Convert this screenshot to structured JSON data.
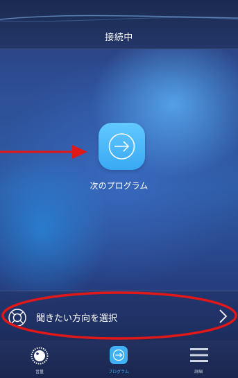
{
  "header": {
    "title": "接続中"
  },
  "main": {
    "next_program_label": "次のプログラム",
    "next_program_icon": "arrow-right-icon"
  },
  "direction_bar": {
    "label": "聞きたい方向を選択",
    "icon": "lifebuoy-icon",
    "chevron": "chevron-right-icon"
  },
  "tabs": [
    {
      "label": "音量",
      "icon": "volume-dial-icon",
      "active": false
    },
    {
      "label": "プログラム",
      "icon": "arrow-right-icon",
      "active": true
    },
    {
      "label": "詳細",
      "icon": "menu-icon",
      "active": false
    }
  ],
  "colors": {
    "accent": "#3fb0f5",
    "annotation": "#e01818",
    "header_bg": "#1b2a50"
  }
}
